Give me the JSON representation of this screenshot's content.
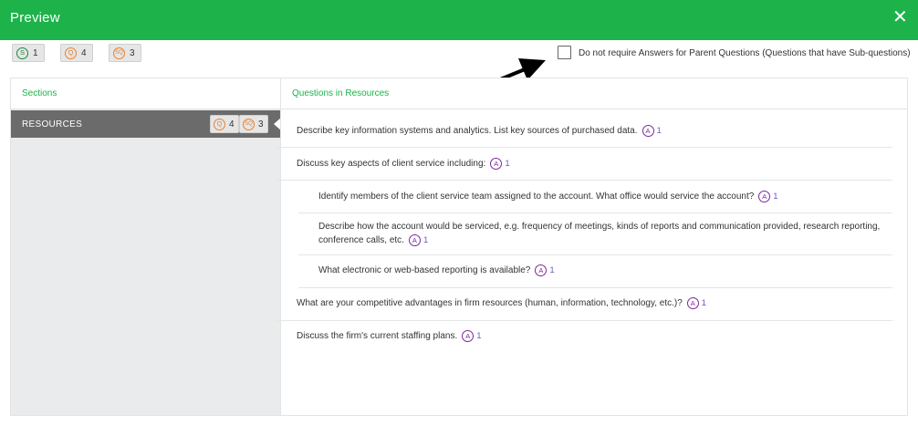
{
  "header": {
    "title": "Preview",
    "close_label": "✕"
  },
  "summary": [
    {
      "icon": "S",
      "count": "1"
    },
    {
      "icon": "Q",
      "count": "4"
    },
    {
      "icon": "SQ",
      "count": "3"
    }
  ],
  "option": {
    "label": "Do not require Answers for Parent Questions (Questions that have Sub-questions)",
    "checked": false
  },
  "sidebar": {
    "heading": "Sections",
    "items": [
      {
        "label": "RESOURCES",
        "q_icon": "Q",
        "q_count": "4",
        "sq_icon": "SQ",
        "sq_count": "3"
      }
    ]
  },
  "main": {
    "heading": "Questions in Resources",
    "questions": [
      {
        "text": "Describe key information systems and analytics. List key sources of purchased data.",
        "ans_icon": "A",
        "ans_count": "1"
      },
      {
        "text": "Discuss key aspects of client service including:",
        "ans_icon": "A",
        "ans_count": "1"
      },
      {
        "text": "Identify members of the client service team assigned to the account. What office would service the account?",
        "ans_icon": "A",
        "ans_count": "1"
      },
      {
        "text_line1": "Describe how the account would be serviced, e.g. frequency of meetings, kinds of reports and communication provided, research reporting,",
        "text_line2": "conference calls, etc.",
        "ans_icon": "A",
        "ans_count": "1"
      },
      {
        "text": "What electronic or web-based reporting is available?",
        "ans_icon": "A",
        "ans_count": "1"
      },
      {
        "text": "What are your competitive advantages in firm resources (human, information, technology, etc.)?",
        "ans_icon": "A",
        "ans_count": "1"
      },
      {
        "text": "Discuss the firm's current staffing plans.",
        "ans_icon": "A",
        "ans_count": "1"
      }
    ]
  },
  "colors": {
    "header": "#1db34a",
    "accent_green": "#1db34a",
    "section_selected": "#6b6b6b",
    "answer_badge": "#7a2a9a"
  }
}
